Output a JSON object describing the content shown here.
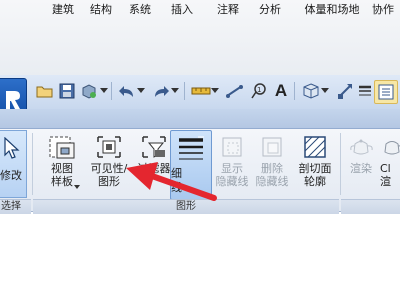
{
  "tabs": [
    "建筑",
    "结构",
    "系统",
    "插入",
    "注释",
    "分析",
    "体量和场地",
    "协作"
  ],
  "ribbon": {
    "modify": {
      "label": "修改"
    },
    "select": {
      "label": "选择"
    },
    "view_template": {
      "line1": "视图",
      "line2": "样板"
    },
    "visibility_graphics": {
      "line1": "可见性/",
      "line2": "图形"
    },
    "filters": {
      "label": "过滤器"
    },
    "thin_lines": {
      "line1": "细",
      "line2": "线"
    },
    "show_hidden": {
      "line1": "显示",
      "line2": "隐藏线"
    },
    "remove_hidden": {
      "line1": "删除",
      "line2": "隐藏线"
    },
    "cut_profile": {
      "line1": "剖切面",
      "line2": "轮廓"
    },
    "render": {
      "label": "渲染"
    },
    "cloud_render": {
      "line1": "Cl",
      "line2": "渲"
    },
    "graphics_panel": {
      "label": "图形"
    }
  },
  "colors": {
    "annotation_arrow": "#e4262f",
    "ribbon_bg": "#e9eef5",
    "tab_bar": "#c4d5ec"
  }
}
